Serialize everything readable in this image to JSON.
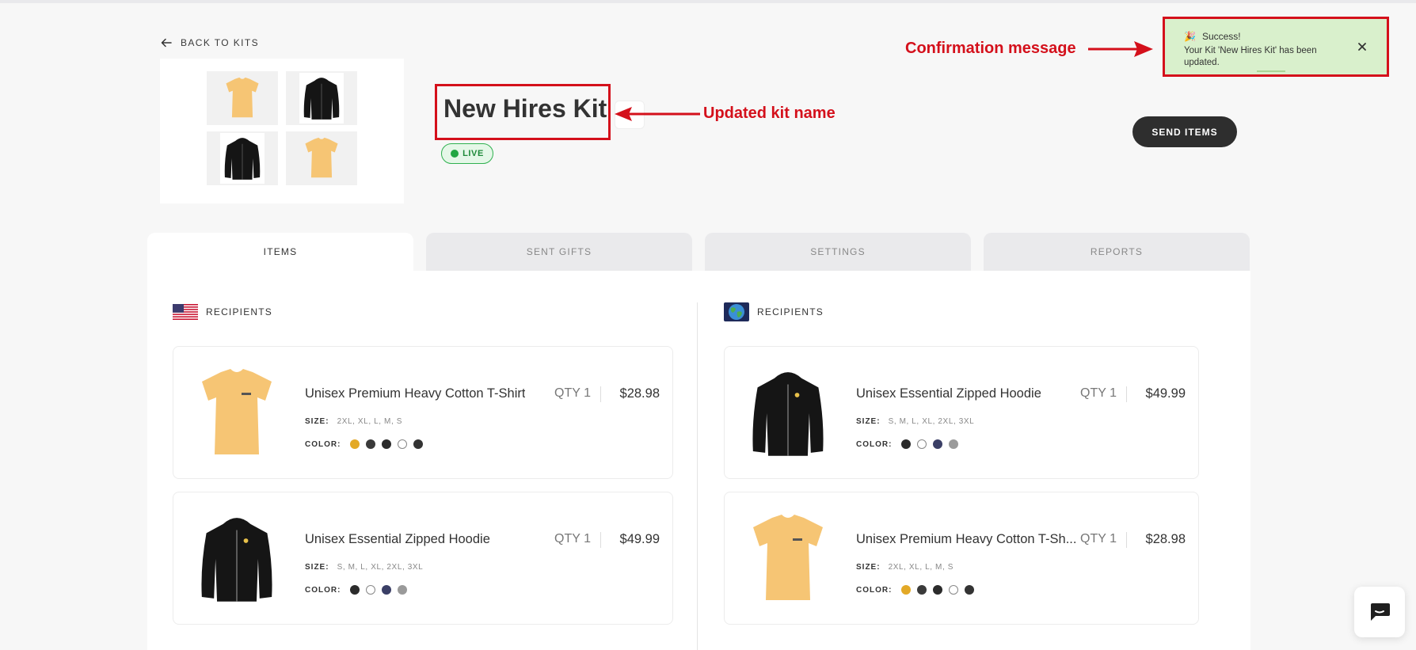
{
  "nav": {
    "back_label": "BACK TO KITS"
  },
  "kit": {
    "name": "New Hires Kit",
    "status": "LIVE",
    "send_label": "SEND ITEMS"
  },
  "annotations": {
    "title_note": "Updated kit name",
    "toast_note": "Confirmation message"
  },
  "toast": {
    "title": "Success!",
    "message": "Your Kit 'New Hires Kit' has been updated."
  },
  "tabs": [
    {
      "label": "ITEMS",
      "active": true
    },
    {
      "label": "SENT GIFTS",
      "active": false
    },
    {
      "label": "SETTINGS",
      "active": false
    },
    {
      "label": "REPORTS",
      "active": false
    }
  ],
  "sections": [
    {
      "flag": "us-flag-icon",
      "title": "RECIPIENTS",
      "items": [
        {
          "name": "Unisex Premium Heavy Cotton T-Shirt",
          "qty": "QTY 1",
          "price": "$28.98",
          "size_label": "SIZE:",
          "sizes": "2XL, XL, L, M, S",
          "color_label": "COLOR:",
          "colors": [
            "#e3a927",
            "#3a3a3a",
            "#2b2b2b",
            "#ffffff",
            "#333333"
          ],
          "type": "tshirt"
        },
        {
          "name": "Unisex Essential Zipped Hoodie",
          "qty": "QTY 1",
          "price": "$49.99",
          "size_label": "SIZE:",
          "sizes": "S, M, L, XL, 2XL, 3XL",
          "color_label": "COLOR:",
          "colors": [
            "#2b2b2b",
            "#ffffff",
            "#3b3f66",
            "#9a9a9a"
          ],
          "type": "hoodie"
        }
      ]
    },
    {
      "flag": "globe-icon",
      "title": "RECIPIENTS",
      "items": [
        {
          "name": "Unisex Essential Zipped Hoodie",
          "qty": "QTY 1",
          "price": "$49.99",
          "size_label": "SIZE:",
          "sizes": "S, M, L, XL, 2XL, 3XL",
          "color_label": "COLOR:",
          "colors": [
            "#2b2b2b",
            "#ffffff",
            "#3b3f66",
            "#9a9a9a"
          ],
          "type": "hoodie"
        },
        {
          "name": "Unisex Premium Heavy Cotton T-Sh...",
          "qty": "QTY 1",
          "price": "$28.98",
          "size_label": "SIZE:",
          "sizes": "2XL, XL, L, M, S",
          "color_label": "COLOR:",
          "colors": [
            "#e3a927",
            "#3a3a3a",
            "#2b2b2b",
            "#ffffff",
            "#333333"
          ],
          "type": "tshirt"
        }
      ]
    }
  ],
  "colors": {
    "accent_red": "#d4101b",
    "live_green": "#2fb14f",
    "toast_bg": "#d9f0cc",
    "tshirt": "#f6c574",
    "hoodie": "#151515"
  }
}
